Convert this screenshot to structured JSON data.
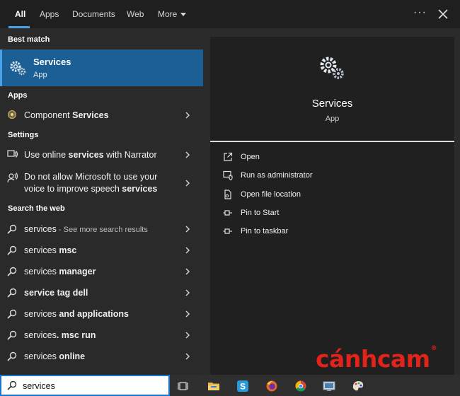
{
  "tabs": [
    {
      "label": "All",
      "active": true
    },
    {
      "label": "Apps"
    },
    {
      "label": "Documents"
    },
    {
      "label": "Web"
    },
    {
      "label": "More"
    }
  ],
  "more_options_label": "···",
  "best_match": {
    "header": "Best match",
    "title": "Services",
    "subtitle": "App"
  },
  "sections": {
    "apps": "Apps",
    "settings": "Settings",
    "web": "Search the web"
  },
  "apps_items": [
    {
      "normal": "Component ",
      "bold": "Services"
    }
  ],
  "settings_items": [
    {
      "normal": "Use online ",
      "bold": "services",
      "normal2": " with Narrator"
    },
    {
      "line1": "Do not allow Microsoft to use your",
      "line2_normal": "voice to improve speech ",
      "line2_bold": "services"
    }
  ],
  "web_items": [
    {
      "normal": "services",
      "muted": " - See more search results",
      "bold": ""
    },
    {
      "normal": "services ",
      "bold": "msc"
    },
    {
      "normal": "services ",
      "bold": "manager"
    },
    {
      "normal": "",
      "bold": "service tag dell"
    },
    {
      "normal": "services ",
      "bold": "and applications"
    },
    {
      "normal": "services",
      "bold": ". msc run"
    },
    {
      "normal": "services ",
      "bold": "online"
    }
  ],
  "preview": {
    "title": "Services",
    "subtitle": "App",
    "actions": [
      {
        "label": "Open",
        "icon": "open-external-icon"
      },
      {
        "label": "Run as administrator",
        "icon": "shield-admin-icon"
      },
      {
        "label": "Open file location",
        "icon": "file-location-icon"
      },
      {
        "label": "Pin to Start",
        "icon": "pin-icon"
      },
      {
        "label": "Pin to taskbar",
        "icon": "pin-icon"
      }
    ]
  },
  "search": {
    "value": "services",
    "placeholder": ""
  },
  "taskbar_icons": [
    "task-view-icon",
    "file-explorer-icon",
    "skype-icon",
    "firefox-icon",
    "chrome-icon",
    "control-panel-icon",
    "paint-icon"
  ],
  "watermark": {
    "text": "cánhcam",
    "mark": "®"
  },
  "colors": {
    "accent": "#4aa3e8",
    "selection": "#1c5f94",
    "watermark": "#e2231a"
  }
}
